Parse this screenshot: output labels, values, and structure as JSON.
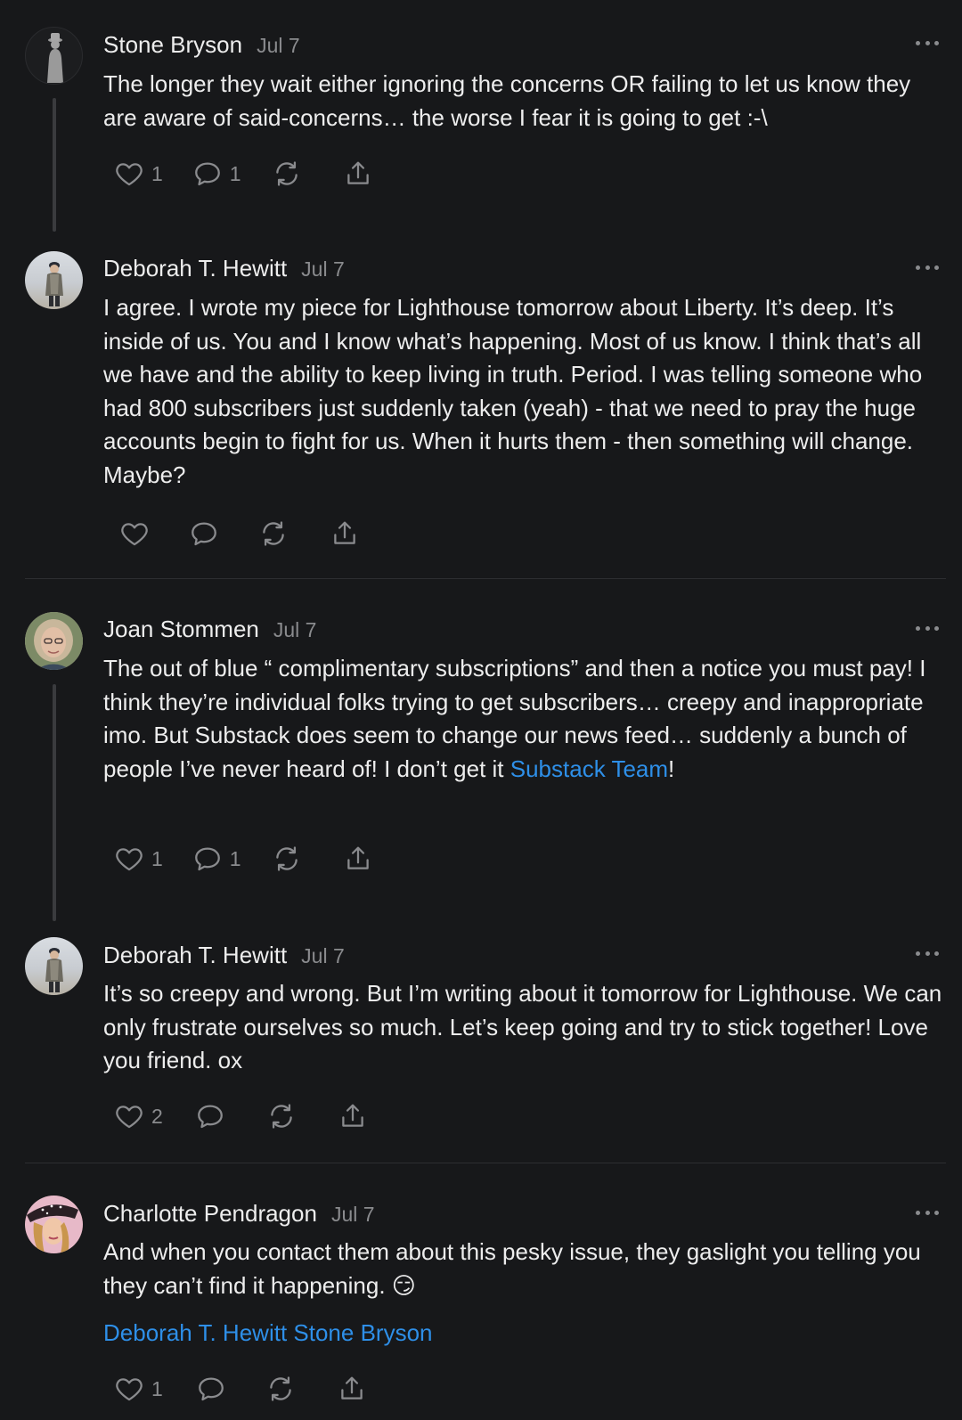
{
  "comments": [
    {
      "author": "Stone Bryson",
      "date": "Jul 7",
      "text": "The longer they wait either ignoring the concerns OR failing to let us know they are aware of said-concerns… the worse I fear it is going to get :-\\",
      "likes": "1",
      "replies": "1"
    },
    {
      "author": "Deborah T. Hewitt",
      "date": "Jul 7",
      "text": "I agree. I wrote my piece for Lighthouse tomorrow about Liberty. It’s deep. It’s inside of us. You and I know what’s happening. Most of us know. I think that’s all we have and the ability to keep living in truth. Period. I was telling someone who had 800 subscribers just suddenly taken (yeah) - that we need to pray the huge accounts begin to fight for us. When it hurts them - then something will change. Maybe?"
    },
    {
      "author": "Joan Stommen",
      "date": "Jul 7",
      "text": "The out of blue “ complimentary subscriptions” and then a notice you must pay! I think they’re individual folks trying to get subscribers… creepy and inappropriate imo. But Substack does seem to change our news feed… suddenly a bunch of people I’ve never heard of! I don’t get it ",
      "mention": "Substack Team",
      "suffix": "!",
      "likes": "1",
      "replies": "1"
    },
    {
      "author": "Deborah T. Hewitt",
      "date": "Jul 7",
      "text": "It’s so creepy and wrong. But I’m writing about it tomorrow for Lighthouse. We can only frustrate ourselves so much. Let’s keep going and try to stick together! Love you friend. ox",
      "likes": "2"
    },
    {
      "author": "Charlotte Pendragon",
      "date": "Jul 7",
      "text": "And when you contact them about this pesky issue, they gaslight you telling you they can’t find it happening. 😏",
      "mentions": [
        "Deborah T. Hewitt",
        "Stone Bryson"
      ],
      "likes": "1"
    }
  ],
  "icons": [
    "heart-icon",
    "comment-icon",
    "restack-icon",
    "share-icon",
    "more-icon"
  ],
  "colors": {
    "background": "#17181a",
    "text": "#ededed",
    "muted": "#8a8b8e",
    "link": "#2e8fe8",
    "thread_line": "#3a3b3e"
  }
}
